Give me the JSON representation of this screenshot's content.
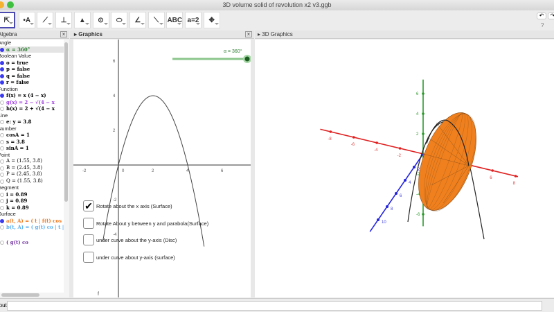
{
  "window": {
    "title": "3D volume solid of revolution x2 v3.ggb"
  },
  "toolbar": {
    "tools": [
      {
        "name": "move-tool",
        "glyph": "⇱"
      },
      {
        "name": "point-tool",
        "glyph": "•A"
      },
      {
        "name": "line-tool",
        "glyph": "⟋"
      },
      {
        "name": "perpendicular-tool",
        "glyph": "⊥"
      },
      {
        "name": "polygon-tool",
        "glyph": "▲"
      },
      {
        "name": "circle-tool",
        "glyph": "⊙"
      },
      {
        "name": "ellipse-tool",
        "glyph": "⬭"
      },
      {
        "name": "angle-tool",
        "glyph": "∠"
      },
      {
        "name": "reflect-tool",
        "glyph": "⟍"
      },
      {
        "name": "text-tool",
        "glyph": "ABC"
      },
      {
        "name": "slider-tool",
        "glyph": "a=2"
      },
      {
        "name": "move-graphics-tool",
        "glyph": "✥"
      }
    ],
    "help": "?"
  },
  "panels": {
    "algebra": "Algebra",
    "graphics": "Graphics",
    "graphics3d": "3D Graphics"
  },
  "algebra": [
    {
      "cat": "Angle"
    },
    {
      "t": "α = 360°",
      "on": true,
      "color": "#2e7d32",
      "hl": true
    },
    {
      "cat": "Boolean Value"
    },
    {
      "t": "o = true",
      "on": true
    },
    {
      "t": "p = false",
      "on": true
    },
    {
      "t": "q = false",
      "on": true
    },
    {
      "t": "r = false",
      "on": true
    },
    {
      "cat": "Function"
    },
    {
      "t": "f(x) = x (4 − x)",
      "on": true
    },
    {
      "t": "g(x) = 2 − √(4 − x",
      "on": false,
      "color": "#a040e0"
    },
    {
      "t": "h(x) = 2 + √(4 − x",
      "on": false
    },
    {
      "cat": "Line"
    },
    {
      "t": "e: y = 3.8",
      "on": false
    },
    {
      "cat": "Number"
    },
    {
      "t": "cosA = 1",
      "on": false
    },
    {
      "t": "s = 3.8",
      "on": false
    },
    {
      "t": "sinA = 1",
      "on": false
    },
    {
      "cat": "Point"
    },
    {
      "t": "A = (1.55, 3.8)",
      "on": false,
      "normal": true
    },
    {
      "t": "B = (2.45, 3.8)",
      "on": false,
      "normal": true
    },
    {
      "t": "P = (2.45, 3.8)",
      "on": false,
      "normal": true
    },
    {
      "t": "Q = (1.55, 3.8)",
      "on": false,
      "normal": true
    },
    {
      "cat": "Segment"
    },
    {
      "t": "i = 0.89",
      "on": false
    },
    {
      "t": "j = 0.89",
      "on": false
    },
    {
      "t": "k = 0.89",
      "on": false
    },
    {
      "cat": "Surface"
    },
    {
      "t": "a(t, A) = ( t | f(t) cos | f(t) sin",
      "on": true,
      "color": "#f07a20"
    },
    {
      "t": "b(t, A) = ( g(t) co | t | g(t) si",
      "on": false,
      "color": "#5ab0f0"
    },
    {
      "t": "( g(t) co",
      "on": false,
      "color": "#7030a0"
    }
  ],
  "graphics": {
    "slider_label": "α = 360°",
    "slider_value": 1.0,
    "curve_label": "f",
    "x_ticks": [
      "-2",
      "0",
      "2",
      "4",
      "6"
    ],
    "y_ticks": [
      "6",
      "4",
      "2",
      "0",
      "-2",
      "-4"
    ],
    "checkboxes": [
      {
        "label": "Rotate about the x axis (Surface)",
        "checked": true
      },
      {
        "label": "Rotate About y between y and parabola(Surface)",
        "checked": false
      },
      {
        "label": "under curve about the y-axis (Disc)",
        "checked": false
      },
      {
        "label": "under curve about y-axis (surface)",
        "checked": false
      }
    ],
    "check_glyph": "✔"
  },
  "view3d": {
    "x_ticks": [
      "-8",
      "-6",
      "-4",
      "-2",
      "6",
      "8"
    ],
    "z_ticks": [
      "6",
      "4",
      "2",
      "-2",
      "-4",
      "-6"
    ],
    "y_ticks": [
      "2",
      "4",
      "6",
      "8",
      "10"
    ],
    "surface_color": "#f0801e"
  },
  "input": {
    "label": "Input:"
  }
}
